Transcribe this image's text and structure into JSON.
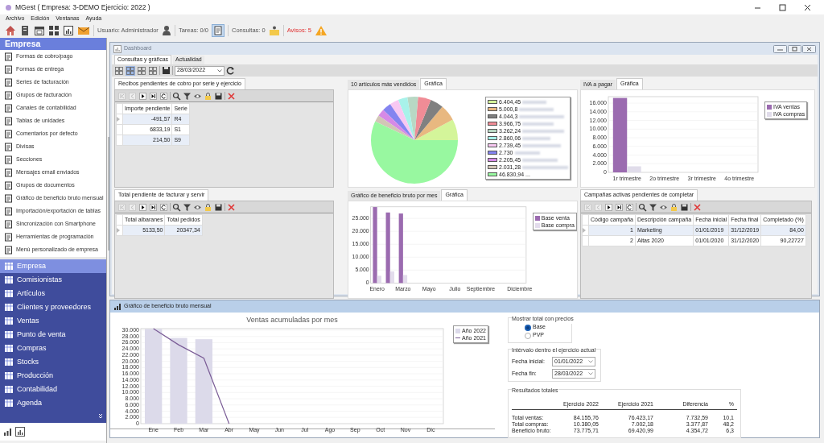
{
  "window": {
    "title": "MGest ( Empresa: 3-DEMO Ejercicio: 2022 )"
  },
  "menu": [
    "Archivo",
    "Edición",
    "Ventanas",
    "Ayuda"
  ],
  "toolbar": {
    "user": "Usuario: Administrador",
    "tasks": "Tareas: 0/0",
    "queries": "Consultas: 0",
    "alerts": "Avisos: 5"
  },
  "sidebar": {
    "title": "Empresa",
    "items": [
      "Formas de cobro/pago",
      "Formas de entrega",
      "Series de facturación",
      "Grupos de facturación",
      "Canales de contabilidad",
      "Tablas de unidades",
      "Comentarios por defecto",
      "Divisas",
      "Secciones",
      "Mensajes email enviados",
      "Grupos de documentos",
      "Gráfico de beneficio bruto mensual",
      "Importación/exportación de tablas",
      "Sincronización con Smartphone",
      "Herramientas de programación",
      "Menú personalizado de empresa"
    ],
    "modules": [
      {
        "label": "Empresa",
        "selected": true
      },
      {
        "label": "Comisionistas",
        "selected": false
      },
      {
        "label": "Artículos",
        "selected": false
      },
      {
        "label": "Clientes y proveedores",
        "selected": false
      },
      {
        "label": "Ventas",
        "selected": false
      },
      {
        "label": "Punto de venta",
        "selected": false
      },
      {
        "label": "Compras",
        "selected": false
      },
      {
        "label": "Stocks",
        "selected": false
      },
      {
        "label": "Producción",
        "selected": false
      },
      {
        "label": "Contabilidad",
        "selected": false
      },
      {
        "label": "Agenda",
        "selected": false
      }
    ]
  },
  "dashboard": {
    "title": "Dashboard",
    "tabs": [
      {
        "label": "Consultas y gráficas",
        "selected": true
      },
      {
        "label": "Actualidad",
        "selected": false
      }
    ],
    "layouts": [
      {
        "selected": false
      },
      {
        "selected": true
      },
      {
        "selected": false
      },
      {
        "selected": false
      }
    ],
    "date": "28/03/2022",
    "panels": [
      {
        "kind": "table",
        "tabs": [
          {
            "label": "Recibos pendientes de cobro por serie y ejercicio",
            "selected": true
          }
        ],
        "columns": [
          "Importe pendiente",
          "Serie"
        ],
        "rows": [
          [
            "-491,57",
            "R4"
          ],
          [
            "6833,19",
            "S1"
          ],
          [
            "214,50",
            "S9"
          ]
        ]
      },
      {
        "kind": "chart",
        "tabs": [
          {
            "label": "10 artículos más vendidos",
            "selected": false
          },
          {
            "label": "Gráfica",
            "selected": true
          }
        ],
        "chart_data": {
          "type": "pie",
          "categories": [
            "6.404,45",
            "5.000,8",
            "4.044,3",
            "3.966,75",
            "3.262,24",
            "2.860,06",
            "2.739,45",
            "2.730",
            "2.205,45",
            "2.031,28",
            "46.830,94 ..."
          ],
          "values": [
            6404.45,
            5000.8,
            4044.3,
            3966.75,
            3262.24,
            2860.06,
            2739.45,
            2730,
            2205.45,
            2031.28,
            46830.94
          ],
          "colors": [
            "#d4f59a",
            "#e8b880",
            "#808080",
            "#f08c96",
            "#b8d8c4",
            "#a8f2ea",
            "#f8c8f2",
            "#8484f0",
            "#d68ae6",
            "#d2c6b6",
            "#98f8a0"
          ],
          "legend": "right"
        }
      },
      {
        "kind": "chart",
        "tabs": [
          {
            "label": "IVA a pagar",
            "selected": false
          },
          {
            "label": "Gráfica",
            "selected": true
          }
        ],
        "chart_data": {
          "type": "bar",
          "categories": [
            "1r trimestre",
            "2o trimestre",
            "3r trimestre",
            "4o trimestre"
          ],
          "series": [
            {
              "name": "IVA ventas",
              "color": "#9b6bb0",
              "values": [
                17200,
                null,
                null,
                null
              ]
            },
            {
              "name": "IVA compras",
              "color": "#e0dcea",
              "values": [
                1400,
                null,
                null,
                null
              ]
            }
          ],
          "legend": "right",
          "grid": true,
          "ylim": [
            0,
            17500
          ],
          "yticks": [
            {
              "value": 0,
              "label": "0"
            },
            {
              "value": 2000,
              "label": "2.000"
            },
            {
              "value": 4000,
              "label": "4.000"
            },
            {
              "value": 6000,
              "label": "6.000"
            },
            {
              "value": 8000,
              "label": "8.000"
            },
            {
              "value": 10000,
              "label": "10.000"
            },
            {
              "value": 12000,
              "label": "12.000"
            },
            {
              "value": 14000,
              "label": "14.000"
            },
            {
              "value": 16000,
              "label": "16.000"
            }
          ]
        }
      },
      {
        "kind": "table",
        "tabs": [
          {
            "label": "Total pendiente de facturar y servir",
            "selected": true
          }
        ],
        "columns": [
          "Total albaranes",
          "Total pedidos"
        ],
        "rows": [
          [
            "5133,50",
            "20347,34"
          ]
        ]
      },
      {
        "kind": "chart",
        "tabs": [
          {
            "label": "Gráfico de beneficio bruto por mes",
            "selected": false
          },
          {
            "label": "Gráfica",
            "selected": true
          }
        ],
        "chart_data": {
          "type": "bar",
          "categories": [
            "Enero",
            null,
            "Marzo",
            null,
            "Mayo",
            null,
            "Julio",
            null,
            "Septiembre",
            null,
            null,
            "Diciembre"
          ],
          "legend": "right",
          "grid": true,
          "series": [
            {
              "name": "Base venta",
              "color": "#9b6bb0",
              "values": [
                29400,
                27300,
                26900,
                null,
                null,
                null,
                null,
                null,
                null,
                null,
                null,
                null
              ]
            },
            {
              "name": "Base compra",
              "color": "#e3dcec",
              "values": [
                2800,
                4500,
                3100,
                null,
                null,
                null,
                null,
                null,
                null,
                null,
                null,
                null
              ]
            }
          ],
          "ylim": [
            0,
            29500
          ],
          "yticks": [
            {
              "value": 0,
              "label": "0"
            },
            {
              "value": 5000,
              "label": "5.000"
            },
            {
              "value": 10000,
              "label": "10.000"
            },
            {
              "value": 15000,
              "label": "15.000"
            },
            {
              "value": 20000,
              "label": "20.000"
            },
            {
              "value": 25000,
              "label": "25.000"
            }
          ]
        }
      },
      {
        "kind": "table",
        "tabs": [
          {
            "label": "Campañas activas pendientes de completar",
            "selected": true
          }
        ],
        "columns": [
          "Código campaña",
          "Descripción campaña",
          "Fecha inicial",
          "Fecha final",
          "Completado (%)"
        ],
        "rows": [
          [
            "1",
            "Marketing",
            "01/01/2019",
            "31/12/2019",
            "84,00"
          ],
          [
            "2",
            "Altas 2020",
            "01/01/2020",
            "31/12/2020",
            "90,22727"
          ]
        ]
      }
    ]
  },
  "monthly": {
    "title": "Gráfico de beneficio bruto mensual",
    "chart_data": {
      "type": "bar",
      "title": "Ventas acumuladas por mes",
      "legend": "right",
      "grid": true,
      "categories": [
        "Ene",
        "Feb",
        "Mar",
        "Abr",
        "May",
        "Jun",
        "Jul",
        "Ago",
        "Sep",
        "Oct",
        "Nov",
        "Dic"
      ],
      "series": [
        {
          "name": "Año 2022",
          "type": "bar",
          "color": "#dcdaea",
          "values": [
            30400,
            27500,
            27100,
            null,
            null,
            null,
            null,
            null,
            null,
            null,
            null,
            null
          ]
        },
        {
          "name": "Año 2021",
          "type": "line",
          "color": "#7a5c96",
          "values": [
            30500,
            25300,
            21000,
            0,
            null,
            null,
            null,
            null,
            null,
            null,
            null,
            null
          ]
        }
      ],
      "ylim": [
        0,
        30500
      ],
      "yticks": [
        {
          "value": 0,
          "label": "0"
        },
        {
          "value": 2000,
          "label": "2.000"
        },
        {
          "value": 4000,
          "label": "4.000"
        },
        {
          "value": 6000,
          "label": "6.000"
        },
        {
          "value": 8000,
          "label": "8.000"
        },
        {
          "value": 10000,
          "label": "10.000"
        },
        {
          "value": 12000,
          "label": "12.000"
        },
        {
          "value": 14000,
          "label": "14.000"
        },
        {
          "value": 16000,
          "label": "16.000"
        },
        {
          "value": 18000,
          "label": "18.000"
        },
        {
          "value": 20000,
          "label": "20.000"
        },
        {
          "value": 22000,
          "label": "22.000"
        },
        {
          "value": 24000,
          "label": "24.000"
        },
        {
          "value": 26000,
          "label": "26.000"
        },
        {
          "value": 28000,
          "label": "28.000"
        },
        {
          "value": 30000,
          "label": "30.000"
        }
      ]
    },
    "prices": {
      "title": "Mostrar total con precios",
      "options": [
        {
          "label": "Base",
          "selected": true
        },
        {
          "label": "PVP",
          "selected": false
        }
      ]
    },
    "interval": {
      "title": "Intérvalo dentro el ejercicio actual",
      "fields": [
        {
          "label": "Fecha inicial:",
          "value": "01/01/2022"
        },
        {
          "label": "Fecha fin:",
          "value": "28/03/2022"
        }
      ]
    },
    "results": {
      "title": "Resultados totales",
      "columns": [
        "Ejercicio 2022",
        "Ejercicio 2021",
        "Diferencia",
        "%"
      ],
      "rows": [
        {
          "label": "Total ventas:",
          "values": [
            "84.155,76",
            "76.423,17",
            "7.732,59",
            "10,1"
          ]
        },
        {
          "label": "Total compras:",
          "values": [
            "10.380,05",
            "7.002,18",
            "3.377,87",
            "48,2"
          ]
        },
        {
          "label": "Beneficio bruto:",
          "values": [
            "73.775,71",
            "69.420,99",
            "4.354,72",
            "6,3"
          ]
        }
      ]
    }
  }
}
